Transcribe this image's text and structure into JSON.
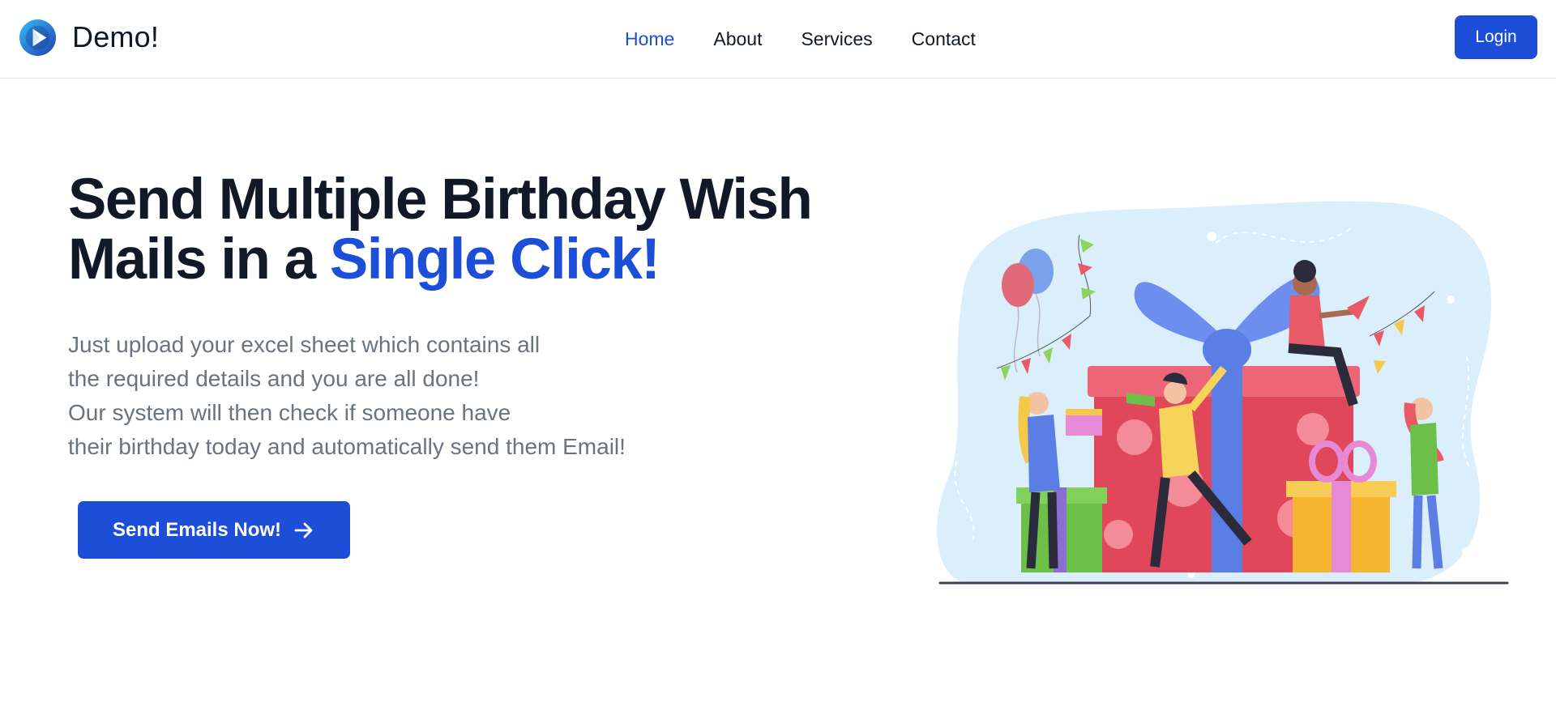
{
  "brand": {
    "name": "Demo!"
  },
  "nav": {
    "items": [
      {
        "label": "Home",
        "active": true
      },
      {
        "label": "About",
        "active": false
      },
      {
        "label": "Services",
        "active": false
      },
      {
        "label": "Contact",
        "active": false
      }
    ]
  },
  "header": {
    "login_label": "Login"
  },
  "hero": {
    "title_line1": "Send Multiple Birthday Wish",
    "title_line2_prefix": "Mails in a ",
    "title_line2_accent": "Single Click!",
    "description_lines": [
      "Just upload your excel sheet which contains all",
      "the required details and you are all done!",
      "Our system will then check if someone have",
      "their birthday today and automatically send them Email!"
    ],
    "cta_label": "Send Emails Now!"
  },
  "icons": {
    "logo": "play-logo-icon",
    "cta_arrow": "arrow-right-icon"
  },
  "colors": {
    "accent": "#1d4ed8",
    "heading": "#111827",
    "body_text": "#6b7280"
  }
}
